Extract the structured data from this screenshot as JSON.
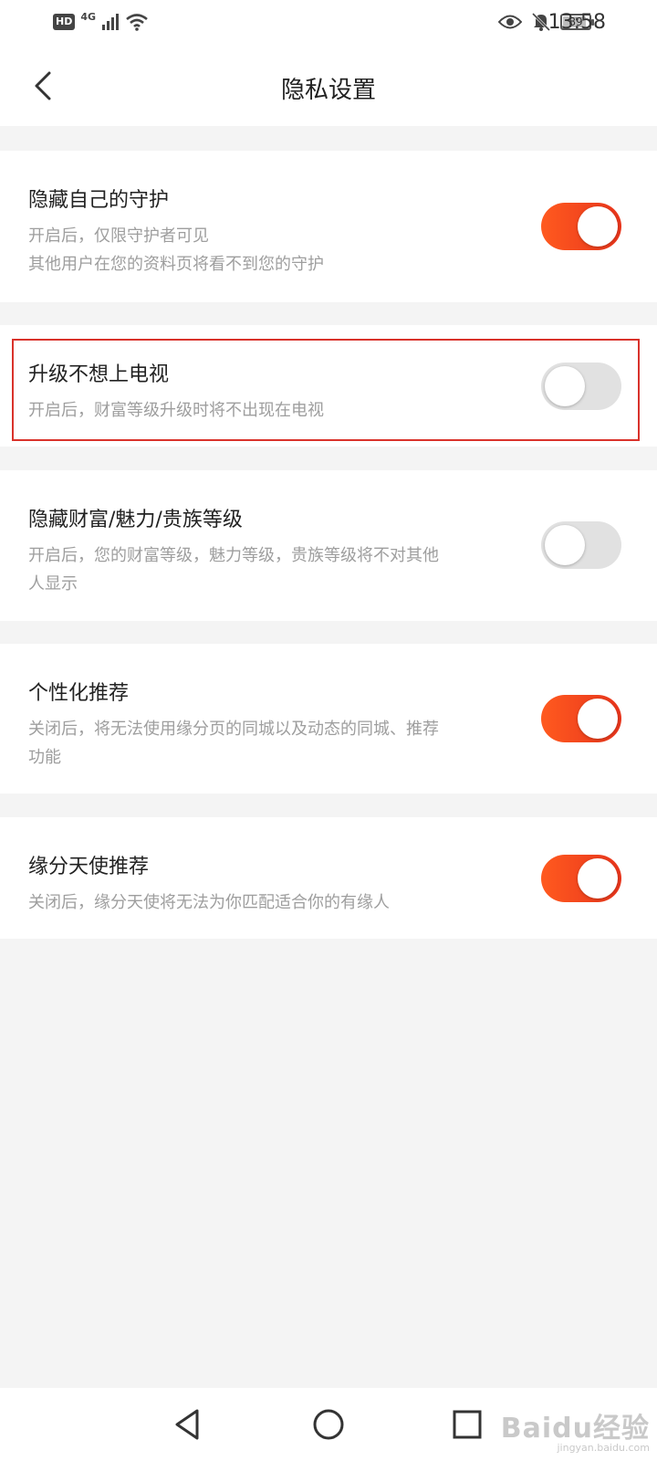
{
  "status_bar": {
    "hd_label": "HD",
    "network_label": "4G",
    "battery": "89",
    "battery_level": 0.89,
    "time": "13:58",
    "icons": [
      "signal-icon",
      "wifi-icon",
      "eye-icon",
      "bell-muted-icon",
      "battery-icon"
    ]
  },
  "header": {
    "title": "隐私设置",
    "back_icon": "back-arrow-icon"
  },
  "settings": [
    {
      "title": "隐藏自己的守护",
      "desc_lines": [
        "开启后，仅限守护者可见",
        "其他用户在您的资料页将看不到您的守护"
      ],
      "enabled": true
    },
    {
      "title": "升级不想上电视",
      "desc_lines": [
        "开启后，财富等级升级时将不出现在电视"
      ],
      "enabled": false,
      "highlighted": true
    },
    {
      "title": "隐藏财富/魅力/贵族等级",
      "desc_lines": [
        "开启后，您的财富等级，魅力等级，贵族等级将不对其他",
        "人显示"
      ],
      "enabled": false
    },
    {
      "title": "个性化推荐",
      "desc_lines": [
        "关闭后，将无法使用缘分页的同城以及动态的同城、推荐",
        "功能"
      ],
      "enabled": true
    },
    {
      "title": "缘分天使推荐",
      "desc_lines": [
        "关闭后，缘分天使将无法为你匹配适合你的有缘人"
      ],
      "enabled": true
    }
  ],
  "nav_bar": {
    "icons": [
      "back-triangle-icon",
      "home-circle-icon",
      "recents-square-icon"
    ]
  },
  "watermark": {
    "logo": "Baidu经验",
    "url": "jingyan.baidu.com"
  },
  "colors": {
    "toggle_on": "#f0471e",
    "toggle_off": "#e1e1e1",
    "highlight_border": "#d9322b",
    "background": "#f4f4f4"
  }
}
